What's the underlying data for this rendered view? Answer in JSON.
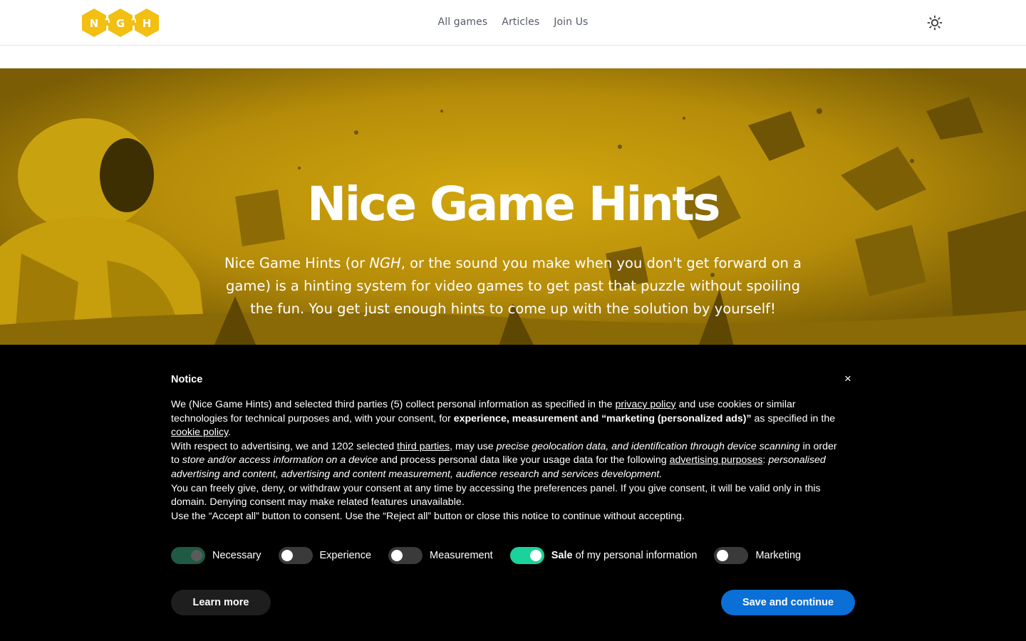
{
  "header": {
    "logo_letters": [
      "N",
      "G",
      "H"
    ],
    "nav": [
      "All games",
      "Articles",
      "Join Us"
    ],
    "theme_icon": "sun-icon"
  },
  "hero": {
    "title": "Nice Game Hints",
    "desc_part1": "Nice Game Hints (or ",
    "desc_em": "NGH",
    "desc_part2": ", or the sound you make when you don't get forward on a game) is a hinting system for video games to get past that puzzle without spoiling the fun. You get just enough hints to come up with the solution by yourself!"
  },
  "notice": {
    "title": "Notice",
    "close_icon": "close-icon",
    "close_glyph": "×",
    "p1": {
      "t1": "We (Nice Game Hints) and selected third parties (5) collect personal information as specified in the ",
      "link1": "privacy policy",
      "t2": " and use cookies or similar technologies for technical purposes and, with your consent, for ",
      "bold": "experience, measurement and “marketing (personalized ads)”",
      "t3": " as specified in the ",
      "link2": "cookie policy",
      "t4": "."
    },
    "p2": {
      "t1": "With respect to advertising, we and 1202 selected ",
      "link1": "third parties",
      "t2": ", may use ",
      "i1": "precise geolocation data, and identification through device scanning",
      "t3": " in order to ",
      "i2": "store and/or access information on a device",
      "t4": " and process personal data like your usage data for the following ",
      "link2": "advertising purposes",
      "t5": ": ",
      "i3": "personalised advertising and content, advertising and content measurement, audience research and services development."
    },
    "p3": "You can freely give, deny, or withdraw your consent at any time by accessing the preferences panel. If you give consent, it will be valid only in this domain. Denying consent may make related features unavailable.",
    "p4": "Use the “Accept all” button to consent. Use the “Reject all” button or close this notice to continue without accepting.",
    "toggles": [
      {
        "label": "Necessary",
        "state": "on-disabled"
      },
      {
        "label": "Experience",
        "state": "off"
      },
      {
        "label": "Measurement",
        "state": "off"
      },
      {
        "label_bold": "Sale",
        "label": " of my personal information",
        "state": "on"
      },
      {
        "label": "Marketing",
        "state": "off"
      }
    ],
    "learn_more": "Learn more",
    "save": "Save and continue"
  },
  "colors": {
    "brand_yellow": "#f2bf12",
    "hero_tint": "#b28a08",
    "accent_blue": "#0a6fd6",
    "toggle_on": "#19d39a"
  }
}
